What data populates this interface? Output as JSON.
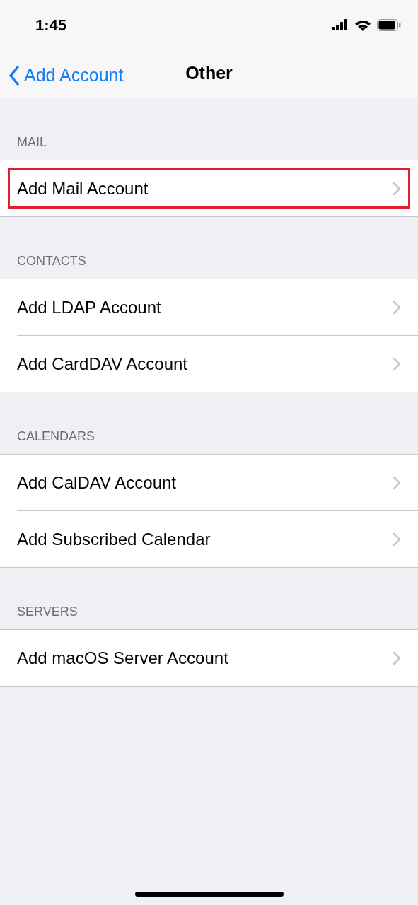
{
  "status_bar": {
    "time": "1:45"
  },
  "nav": {
    "back": "Add Account",
    "title": "Other"
  },
  "sections": [
    {
      "header": "MAIL",
      "rows": [
        {
          "label": "Add Mail Account",
          "highlighted": true
        }
      ]
    },
    {
      "header": "CONTACTS",
      "rows": [
        {
          "label": "Add LDAP Account",
          "highlighted": false
        },
        {
          "label": "Add CardDAV Account",
          "highlighted": false
        }
      ]
    },
    {
      "header": "CALENDARS",
      "rows": [
        {
          "label": "Add CalDAV Account",
          "highlighted": false
        },
        {
          "label": "Add Subscribed Calendar",
          "highlighted": false
        }
      ]
    },
    {
      "header": "SERVERS",
      "rows": [
        {
          "label": "Add macOS Server Account",
          "highlighted": false
        }
      ]
    }
  ]
}
